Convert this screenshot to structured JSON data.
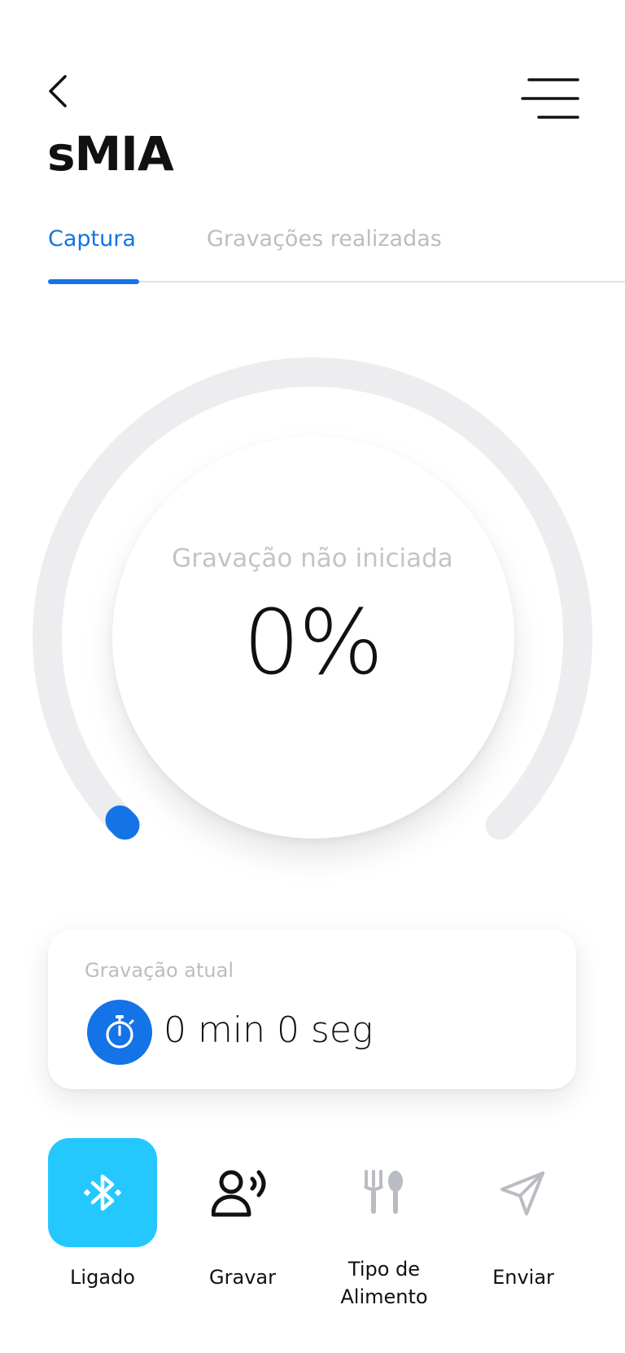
{
  "header": {
    "title": "sMIA",
    "back_icon": "chevron-left-icon",
    "menu_icon": "menu-icon"
  },
  "tabs": [
    {
      "label": "Captura",
      "active": true
    },
    {
      "label": "Gravações realizadas",
      "active": false
    }
  ],
  "gauge": {
    "status": "Gravação não iniciada",
    "percent_text": "0%",
    "progress": 0.0
  },
  "current_recording": {
    "label": "Gravação atual",
    "time": "0 min 0 seg",
    "icon": "stopwatch-icon"
  },
  "actions": [
    {
      "label": "Ligado",
      "icon": "bluetooth-icon",
      "active": true
    },
    {
      "label": "Gravar",
      "icon": "voice-record-icon",
      "active": false
    },
    {
      "label": "Tipo de\nAlimento",
      "icon": "utensils-icon",
      "active": false
    },
    {
      "label": "Enviar",
      "icon": "send-icon",
      "active": false
    }
  ],
  "colors": {
    "accent": "#1473e6",
    "bluetooth_active": "#24c8ff",
    "track": "#ededef",
    "muted_text": "#bdbdbd"
  }
}
